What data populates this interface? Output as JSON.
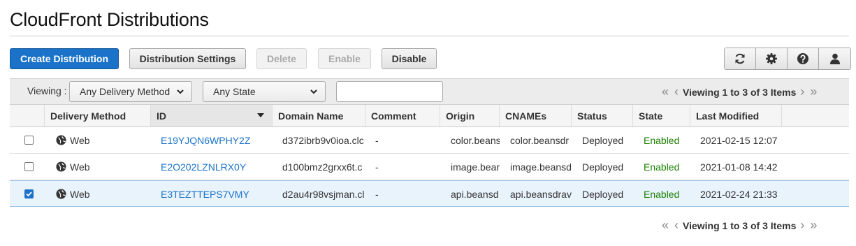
{
  "page": {
    "title": "CloudFront Distributions"
  },
  "toolbar": {
    "create_label": "Create Distribution",
    "settings_label": "Distribution Settings",
    "delete_label": "Delete",
    "enable_label": "Enable",
    "disable_label": "Disable",
    "icons": [
      "refresh-icon",
      "gear-icon",
      "help-icon",
      "user-icon"
    ]
  },
  "filter": {
    "viewing_label": "Viewing :",
    "delivery_method": "Any Delivery Method",
    "state": "Any State",
    "search_value": ""
  },
  "pager": {
    "text": "Viewing 1 to 3 of 3 Items"
  },
  "table": {
    "headers": [
      "Delivery Method",
      "ID",
      "Domain Name",
      "Comment",
      "Origin",
      "CNAMEs",
      "Status",
      "State",
      "Last Modified"
    ],
    "rows": [
      {
        "checked": false,
        "delivery": "Web",
        "id": "E19YJQN6WPHY2Z",
        "domain": "d372ibrb9v0ioa.clc",
        "comment": "-",
        "origin": "color.beans",
        "cnames": "color.beansdr",
        "status": "Deployed",
        "state": "Enabled",
        "modified": "2021-02-15 12:07"
      },
      {
        "checked": false,
        "delivery": "Web",
        "id": "E2O202LZNLRX0Y",
        "domain": "d100bmz2grxx6t.c",
        "comment": "-",
        "origin": "image.bear",
        "cnames": "image.beansd",
        "status": "Deployed",
        "state": "Enabled",
        "modified": "2021-01-08 14:42"
      },
      {
        "checked": true,
        "delivery": "Web",
        "id": "E3TEZTTEPS7VMY",
        "domain": "d2au4r98vsjman.cl",
        "comment": "-",
        "origin": "api.beansd",
        "cnames": "api.beansdrav",
        "status": "Deployed",
        "state": "Enabled",
        "modified": "2021-02-24 21:33"
      }
    ]
  },
  "colors": {
    "primary": "#1a73c9",
    "link": "#1a73c9",
    "enabled": "#1d8102"
  }
}
